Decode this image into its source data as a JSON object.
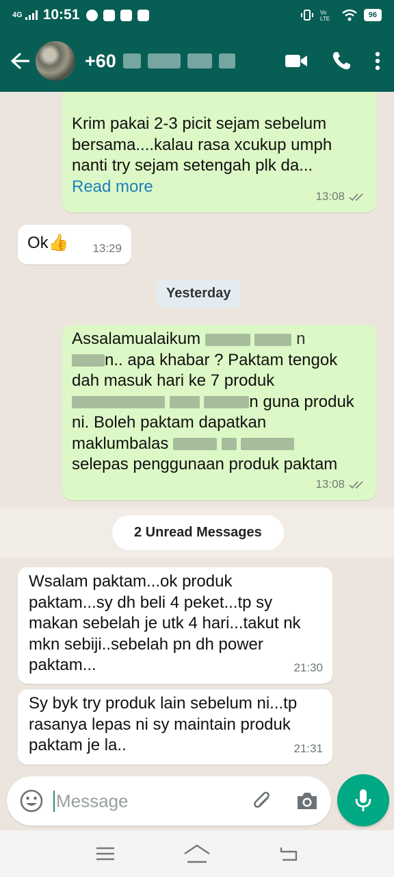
{
  "status_bar": {
    "network": "4G",
    "time": "10:51",
    "battery": "96"
  },
  "header": {
    "contact_prefix": "+60"
  },
  "messages": [
    {
      "direction": "outgoing",
      "lines": [
        "Krim pakai 2-3 picit sejam sebelum",
        "bersama....kalau rasa xcukup umph",
        "nanti try sejam setengah plk da..."
      ],
      "read_more": "Read more",
      "time": "13:08"
    },
    {
      "direction": "incoming",
      "text": "Ok👍",
      "time": "13:29"
    },
    {
      "direction": "outgoing",
      "lines": [
        "Assalamualaikum",
        "n.. apa khabar ? Paktam tengok",
        "dah masuk hari ke 7 produk",
        "n guna produk",
        "ni. Boleh paktam dapatkan",
        "maklumbalas",
        "selepas penggunaan produk paktam"
      ],
      "time": "13:08"
    },
    {
      "direction": "incoming",
      "lines": [
        "Wsalam paktam...ok produk",
        "paktam...sy dh beli 4 peket...tp sy",
        "makan sebelah je utk 4 hari...takut nk",
        "mkn sebiji..sebelah pn dh power",
        "paktam..."
      ],
      "time": "21:30"
    },
    {
      "direction": "incoming",
      "lines": [
        "Sy byk try produk lain sebelum ni...tp",
        "rasanya lepas ni sy maintain produk",
        "paktam je la.."
      ],
      "time": "21:31"
    }
  ],
  "date_chip": "Yesterday",
  "unread_label": "2 Unread Messages",
  "composer": {
    "placeholder": "Message"
  },
  "colors": {
    "header": "#075e54",
    "outgoing_bubble": "#dcf8c6",
    "incoming_bubble": "#ffffff",
    "mic_button": "#00a884",
    "link": "#1f7fbf"
  },
  "icons": [
    "back-arrow-icon",
    "video-call-icon",
    "phone-icon",
    "more-vert-icon",
    "emoji-icon",
    "attach-icon",
    "camera-icon",
    "mic-icon",
    "menu-icon",
    "home-icon",
    "back-icon"
  ]
}
